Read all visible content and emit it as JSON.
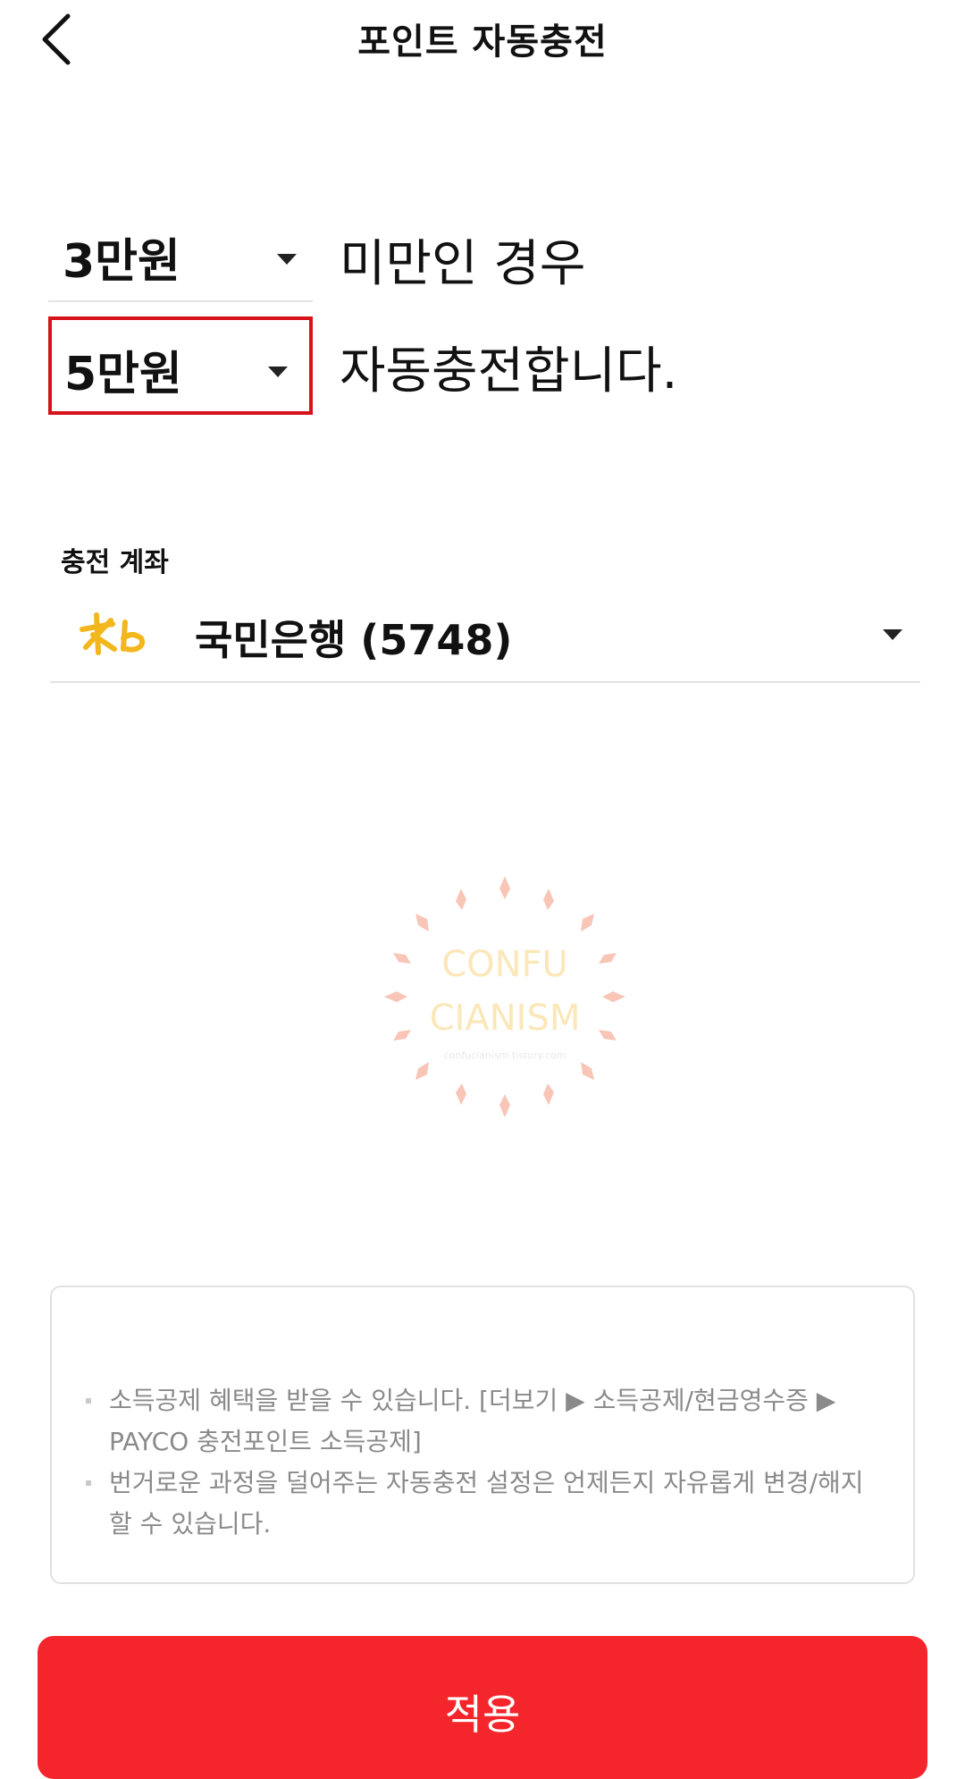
{
  "header": {
    "title": "포인트 자동충전",
    "back_icon": "back-arrow-icon"
  },
  "threshold": {
    "value": "3만원",
    "suffix": "미만인 경우"
  },
  "charge": {
    "value": "5만원",
    "suffix": "자동충전합니다."
  },
  "account": {
    "label": "충전 계좌",
    "bank_logo": "kb-bank-logo",
    "name": "국민은행 (5748)"
  },
  "watermark": {
    "line1": "CONFU",
    "line2": "CIANISM",
    "url": "confucianism.tistory.com"
  },
  "notices": [
    "소득공제 혜택을 받을 수 있습니다. [더보기 ▶ 소득공제/현금영수증 ▶ PAYCO 충전포인트 소득공제]",
    "번거로운 과정을 덜어주는 자동충전 설정은 언제든지 자유롭게 변경/해지할 수 있습니다."
  ],
  "apply_button": {
    "label": "적용"
  },
  "colors": {
    "primary": "#f5262b",
    "highlight_border": "#d6121a",
    "kb_yellow": "#f2b71d",
    "notice_text": "#8a8a8a"
  }
}
